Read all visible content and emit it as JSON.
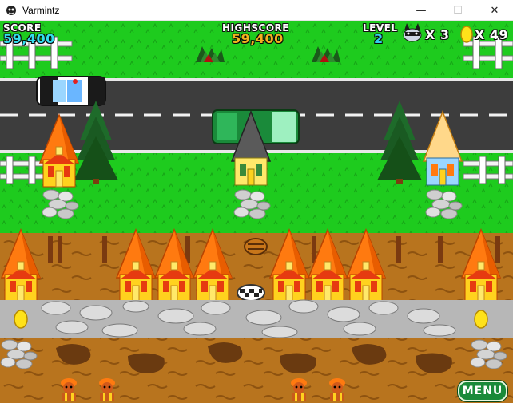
{
  "window": {
    "title": "Varmintz",
    "minimize_glyph": "—",
    "maximize_glyph": "☐",
    "close_glyph": "✕"
  },
  "hud": {
    "score_label": "SCORE",
    "score_value": "59,400",
    "highscore_label": "HIGHSCORE",
    "highscore_value": "59,400",
    "level_label": "LEVEL",
    "level_value": "2",
    "lives_value": "X 3",
    "eggs_value": "X 49"
  },
  "menu_label": "MENU",
  "colors": {
    "grass": "#1ecb1e",
    "road": "#3d3d3d",
    "dirt": "#b8741e",
    "score_value": "#33ddee",
    "highscore_value": "#f2b21e",
    "level_value": "#33ccee",
    "menu_button": "#1a8a3a"
  },
  "icons": {
    "lives": "raccoon-head-icon",
    "eggs": "golden-egg-icon",
    "app": "varmintz-app-icon"
  }
}
